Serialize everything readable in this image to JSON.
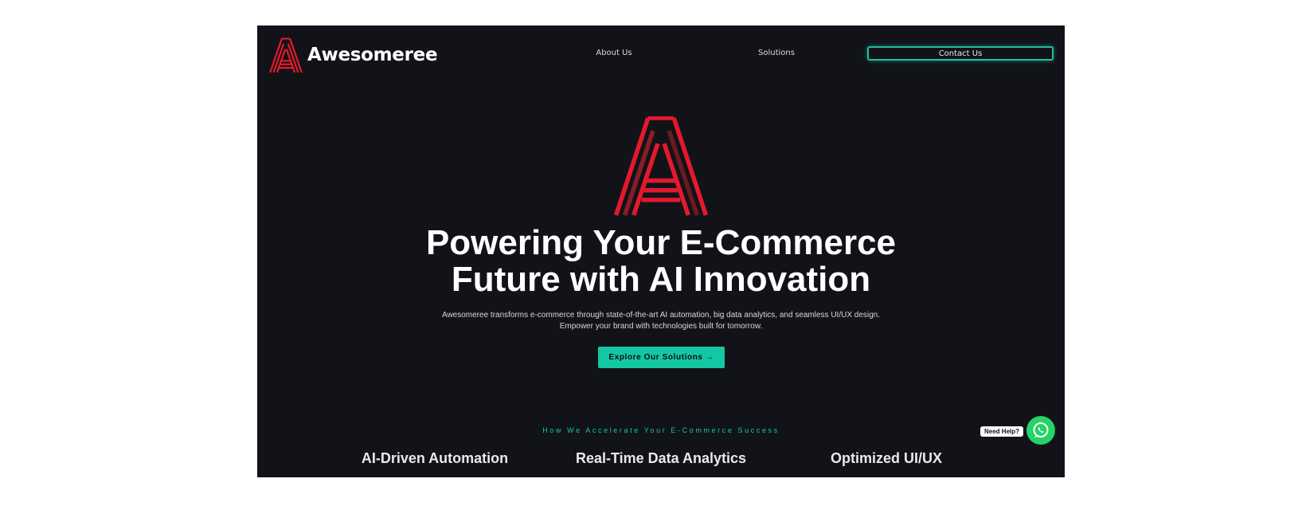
{
  "header": {
    "brand_name": "Awesomeree",
    "logo_icon": "awesomeree-a-logo-icon",
    "nav": [
      {
        "label": "About Us"
      },
      {
        "label": "Solutions"
      }
    ],
    "contact_label": "Contact Us"
  },
  "hero": {
    "logo_icon": "awesomeree-a-logo-icon",
    "title_line1": "Powering Your E-Commerce",
    "title_line2": "Future with AI Innovation",
    "subtitle_line1": "Awesomeree transforms e-commerce through state-of-the-art AI automation, big data analytics, and seamless UI/UX design.",
    "subtitle_line2": "Empower your brand with technologies built for tomorrow.",
    "cta_label": "Explore Our Solutions →"
  },
  "features_section": {
    "tagline": "How We Accelerate Your E-Commerce Success",
    "items": [
      {
        "title": "AI-Driven Automation"
      },
      {
        "title": "Real-Time Data Analytics"
      },
      {
        "title": "Optimized UI/UX"
      }
    ]
  },
  "help_widget": {
    "label": "Need Help?",
    "icon": "whatsapp-icon"
  },
  "colors": {
    "background": "#111318",
    "accent": "#14c7a3",
    "brand_red": "#e3192d",
    "brand_dark_red": "#6b1a22",
    "whatsapp_green": "#25d366"
  }
}
